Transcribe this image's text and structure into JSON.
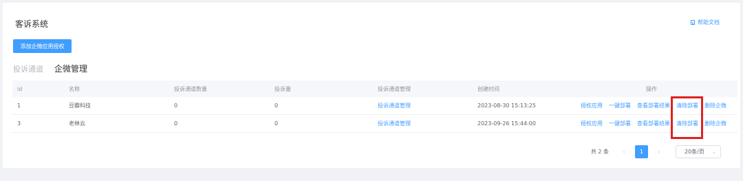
{
  "page": {
    "title": "客诉系统",
    "help_label": "帮助文档"
  },
  "toolbar": {
    "add_button_label": "添加企微应用授权"
  },
  "tabs": [
    {
      "label": "投诉通道",
      "active": false
    },
    {
      "label": "企微管理",
      "active": true
    }
  ],
  "table": {
    "columns": [
      "id",
      "名称",
      "投诉通道数量",
      "投诉量",
      "投诉通道管理",
      "创建时间",
      "操作"
    ],
    "rows": [
      {
        "id": "1",
        "name": "豆瓣科技",
        "channel_count": "0",
        "complaint_count": "0",
        "channel_manage": "投诉通道管理",
        "created_at": "2023-08-30 15:13:25",
        "actions": [
          "授权应用",
          "一键部署",
          "查看部署结果",
          "清除部署",
          "删除企微"
        ]
      },
      {
        "id": "3",
        "name": "老林云",
        "channel_count": "0",
        "complaint_count": "0",
        "channel_manage": "投诉通道管理",
        "created_at": "2023-09-26 15:44:00",
        "actions": [
          "授权应用",
          "一键部署",
          "查看部署结果",
          "清除部署",
          "删除企微"
        ]
      }
    ]
  },
  "pagination": {
    "total_text": "共 2 条",
    "prev_icon": "‹",
    "current_page": "1",
    "next_icon": "›",
    "page_size": "20条/页",
    "page_size_icon": "⌄"
  },
  "colors": {
    "primary": "#409eff",
    "highlight": "#e02020"
  }
}
